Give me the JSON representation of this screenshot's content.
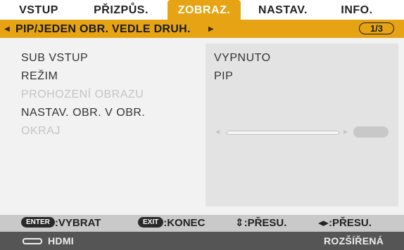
{
  "tabs": [
    {
      "label": "VSTUP",
      "active": false
    },
    {
      "label": "PŘIZPŮS.",
      "active": false
    },
    {
      "label": "ZOBRAZ.",
      "active": true
    },
    {
      "label": "NASTAV.",
      "active": false
    },
    {
      "label": "INFO.",
      "active": false
    }
  ],
  "submenu": {
    "left_arrow": "◀",
    "title": "PIP/JEDEN OBR. VEDLE DRUH.",
    "right_arrow": "▶",
    "page": "1/3"
  },
  "settings": [
    {
      "label": "SUB VSTUP",
      "value": "VYPNUTO",
      "enabled": true
    },
    {
      "label": "REŽIM",
      "value": "PIP",
      "enabled": true
    },
    {
      "label": "PROHOZENÍ OBRAZU",
      "value": "",
      "enabled": false
    },
    {
      "label": "NASTAV. OBR. V OBR.",
      "value": "",
      "enabled": true
    },
    {
      "label": "OKRAJ",
      "value": "",
      "enabled": false
    }
  ],
  "slider": {
    "left_arrow": "◀",
    "right_arrow": "▶"
  },
  "help": {
    "enter_key": "ENTER",
    "enter_action": ":VYBRAT",
    "exit_key": "EXIT",
    "exit_action": ":KONEC",
    "updown": "⇕:PŘESU.",
    "leftright": "◂▸:PŘESU."
  },
  "status": {
    "icon": "hdmi-port-icon",
    "input": "HDMI",
    "mode": "ROZŠÍŘENÁ"
  },
  "colors": {
    "accent": "#e6a414",
    "disabled_text": "#c4c4c4",
    "status_bar": "#555555",
    "help_bar": "#c9c9c9"
  }
}
